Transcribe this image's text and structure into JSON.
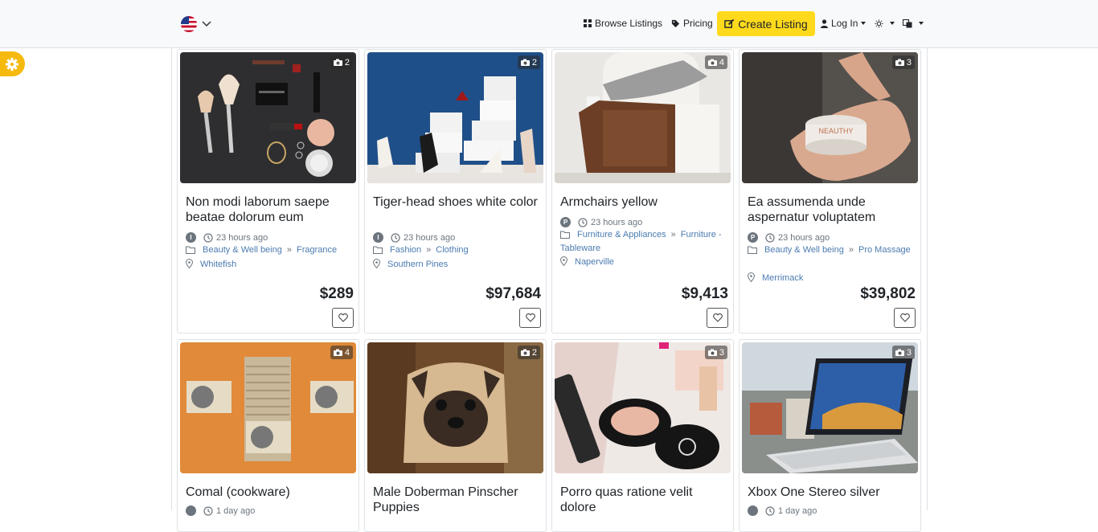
{
  "navbar": {
    "locale": "en-US",
    "browse_label": "Browse Listings",
    "pricing_label": "Pricing",
    "create_label": "Create Listing",
    "login_label": "Log In",
    "colors": {
      "accent": "#ffd91c",
      "gear": "#f6b90e",
      "link": "#4b7bb0"
    }
  },
  "listings": [
    {
      "title": "Non modi laborum saepe beatae dolorum eum",
      "avatar": "I",
      "posted": "23 hours ago",
      "category": "Beauty & Well being",
      "subcategory": "Fragrance",
      "location": "Whitefish",
      "price": "$289",
      "photos": "2"
    },
    {
      "title": "Tiger-head shoes white color",
      "avatar": "I",
      "posted": "23 hours ago",
      "category": "Fashion",
      "subcategory": "Clothing",
      "location": "Southern Pines",
      "price": "$97,684",
      "photos": "2"
    },
    {
      "title": "Armchairs yellow",
      "avatar": "P",
      "posted": "23 hours ago",
      "category": "Furniture & Appliances",
      "subcategory": "Furniture - Tableware",
      "location": "Naperville",
      "price": "$9,413",
      "photos": "4"
    },
    {
      "title": "Ea assumenda unde aspernatur voluptatem",
      "avatar": "P",
      "posted": "23 hours ago",
      "category": "Beauty & Well being",
      "subcategory": "Pro Massage",
      "location": "Merrimack",
      "price": "$39,802",
      "photos": "3"
    },
    {
      "title": "Comal (cookware)",
      "posted": "1 day ago",
      "photos": "4"
    },
    {
      "title": "Male Doberman Pinscher Puppies",
      "photos": "2"
    },
    {
      "title": "Porro quas ratione velit dolore",
      "photos": "3"
    },
    {
      "title": "Xbox One Stereo silver",
      "posted": "1 day ago",
      "photos": "3"
    }
  ]
}
